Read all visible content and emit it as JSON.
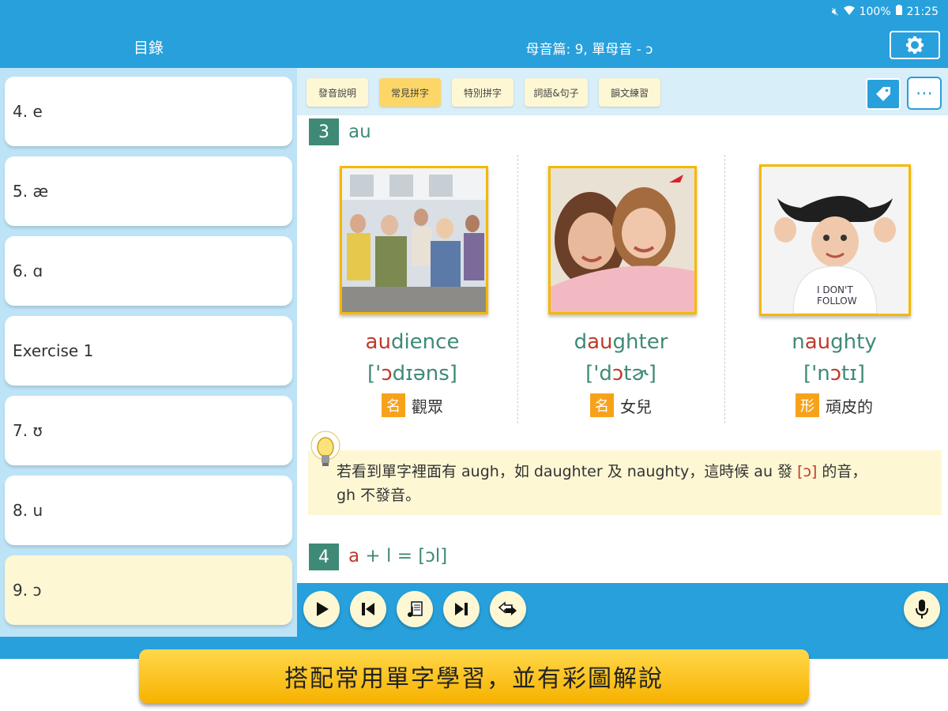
{
  "status": {
    "battery": "100%",
    "time": "21:25"
  },
  "header": {
    "toc_title": "目錄",
    "lesson_title": "母音篇: 9, 單母音 - ɔ"
  },
  "sidebar": {
    "items": [
      {
        "label": "4. e"
      },
      {
        "label": "5. æ"
      },
      {
        "label": "6. ɑ"
      },
      {
        "label": "Exercise 1"
      },
      {
        "label": "7. ʊ"
      },
      {
        "label": "8. u"
      },
      {
        "label": "9. ɔ",
        "selected": true
      }
    ]
  },
  "tabs": [
    {
      "label": "發音說明"
    },
    {
      "label": "常見拼字",
      "active": true
    },
    {
      "label": "特別拼字"
    },
    {
      "label": "詞語&句子"
    },
    {
      "label": "韻文練習"
    }
  ],
  "section3": {
    "num": "3",
    "title": "au"
  },
  "cards": [
    {
      "word_pre": "",
      "word_hl": "au",
      "word_post": "dience",
      "ipa_pre": "['",
      "ipa_hl": "ɔ",
      "ipa_post": "dɪəns]",
      "pos": "名",
      "meaning": "觀眾"
    },
    {
      "word_pre": "d",
      "word_hl": "au",
      "word_post": "ghter",
      "ipa_pre": "['d",
      "ipa_hl": "ɔ",
      "ipa_post": "tɚ]",
      "pos": "名",
      "meaning": "女兒"
    },
    {
      "word_pre": "n",
      "word_hl": "au",
      "word_post": "ghty",
      "ipa_pre": "['n",
      "ipa_hl": "ɔ",
      "ipa_post": "tɪ]",
      "pos": "形",
      "meaning": "頑皮的"
    }
  ],
  "tip": {
    "line1_a": "若看到單字裡面有 augh，如 daughter 及 naughty，這時候 au 發 ",
    "line1_hl": "[ɔ]",
    "line1_b": " 的音，",
    "line2": "gh 不發音。"
  },
  "section4": {
    "num": "4",
    "title_a": "a",
    "title_b": " + l = [ɔl]"
  },
  "banner": {
    "text": "搭配常用單字學習，並有彩圖解說"
  },
  "colors": {
    "primary": "#27a0dc",
    "accent": "#fcd767",
    "teal": "#3f8a77",
    "highlight": "#c0392b"
  }
}
